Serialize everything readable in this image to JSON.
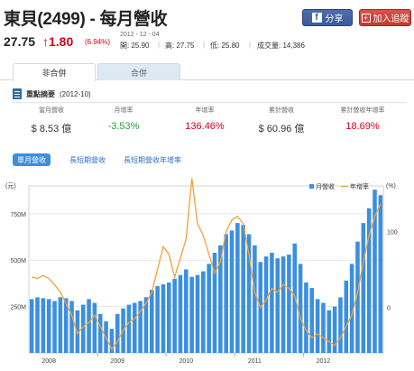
{
  "header": {
    "title": "東貝(2499) - 每月營收",
    "share_label": "分享",
    "track_label": "加入追蹤",
    "facebook_glyph": "f",
    "plus_glyph": "+"
  },
  "quote": {
    "price": "27.75",
    "change": "1.80",
    "change_arrow": "↑",
    "change_pct": "(6.94%)",
    "date": "2012 - 12 - 04",
    "open_label": "開:",
    "open": "25.90",
    "high_label": "高:",
    "high": "27.75",
    "low_label": "低:",
    "low": "25.80",
    "volume_label": "成交量:",
    "volume": "14,386",
    "up_color": "#d0021b"
  },
  "tabs": [
    {
      "label": "非合併",
      "active": true
    },
    {
      "label": "合併",
      "active": false
    }
  ],
  "summary": {
    "heading": "重點摘要",
    "period": "(2012-10)",
    "metrics": [
      {
        "label": "當月營收",
        "value": "$ 8.53 億",
        "tone": "plain"
      },
      {
        "label": "月增率",
        "value": "-3.53%",
        "tone": "down"
      },
      {
        "label": "年增率",
        "value": "136.46%",
        "tone": "up"
      },
      {
        "label": "累計營收",
        "value": "$ 60.96 億",
        "tone": "plain"
      },
      {
        "label": "累計營收年增率",
        "value": "18.69%",
        "tone": "up"
      }
    ]
  },
  "subtabs": [
    {
      "label": "單月營收",
      "active": true
    },
    {
      "label": "長短期營收",
      "active": false
    },
    {
      "label": "長短期營收年增率",
      "active": false
    }
  ],
  "chart_data": {
    "type": "bar",
    "left_unit": "(元)",
    "right_unit": "(%)",
    "left_ticks": [
      {
        "value": 250,
        "label": "250M"
      },
      {
        "value": 500,
        "label": "500M"
      },
      {
        "value": 750,
        "label": "750M"
      }
    ],
    "right_ticks": [
      {
        "value": 0,
        "label": "0"
      },
      {
        "value": 100,
        "label": "100"
      }
    ],
    "left_range": [
      0,
      900
    ],
    "right_range": [
      -60,
      160
    ],
    "x_labels": [
      {
        "index": 3,
        "label": "2008"
      },
      {
        "index": 15,
        "label": "2009"
      },
      {
        "index": 27,
        "label": "2010"
      },
      {
        "index": 39,
        "label": "2011"
      },
      {
        "index": 51,
        "label": "2012"
      }
    ],
    "series": [
      {
        "name": "月營收",
        "kind": "bar",
        "color": "#3b8fe0",
        "values": [
          290,
          300,
          295,
          290,
          280,
          300,
          295,
          280,
          230,
          260,
          290,
          270,
          210,
          170,
          130,
          210,
          240,
          260,
          270,
          280,
          300,
          340,
          360,
          370,
          380,
          400,
          420,
          450,
          410,
          420,
          440,
          480,
          540,
          580,
          640,
          660,
          700,
          690,
          640,
          580,
          490,
          520,
          540,
          510,
          520,
          530,
          590,
          480,
          380,
          350,
          290,
          270,
          230,
          250,
          300,
          390,
          480,
          600,
          700,
          780,
          880,
          850
        ]
      },
      {
        "name": "年增率",
        "kind": "line",
        "color": "#f5a039",
        "values": [
          40,
          38,
          42,
          38,
          30,
          20,
          5,
          -10,
          -35,
          -25,
          -20,
          -10,
          -25,
          -40,
          -55,
          -45,
          -30,
          -20,
          -15,
          -5,
          5,
          20,
          50,
          80,
          70,
          40,
          65,
          90,
          170,
          110,
          95,
          70,
          45,
          60,
          100,
          115,
          120,
          110,
          70,
          20,
          0,
          10,
          25,
          20,
          30,
          25,
          15,
          -15,
          -30,
          -40,
          -35,
          -40,
          -45,
          -50,
          -40,
          -25,
          -10,
          20,
          60,
          95,
          120,
          136
        ]
      }
    ]
  }
}
